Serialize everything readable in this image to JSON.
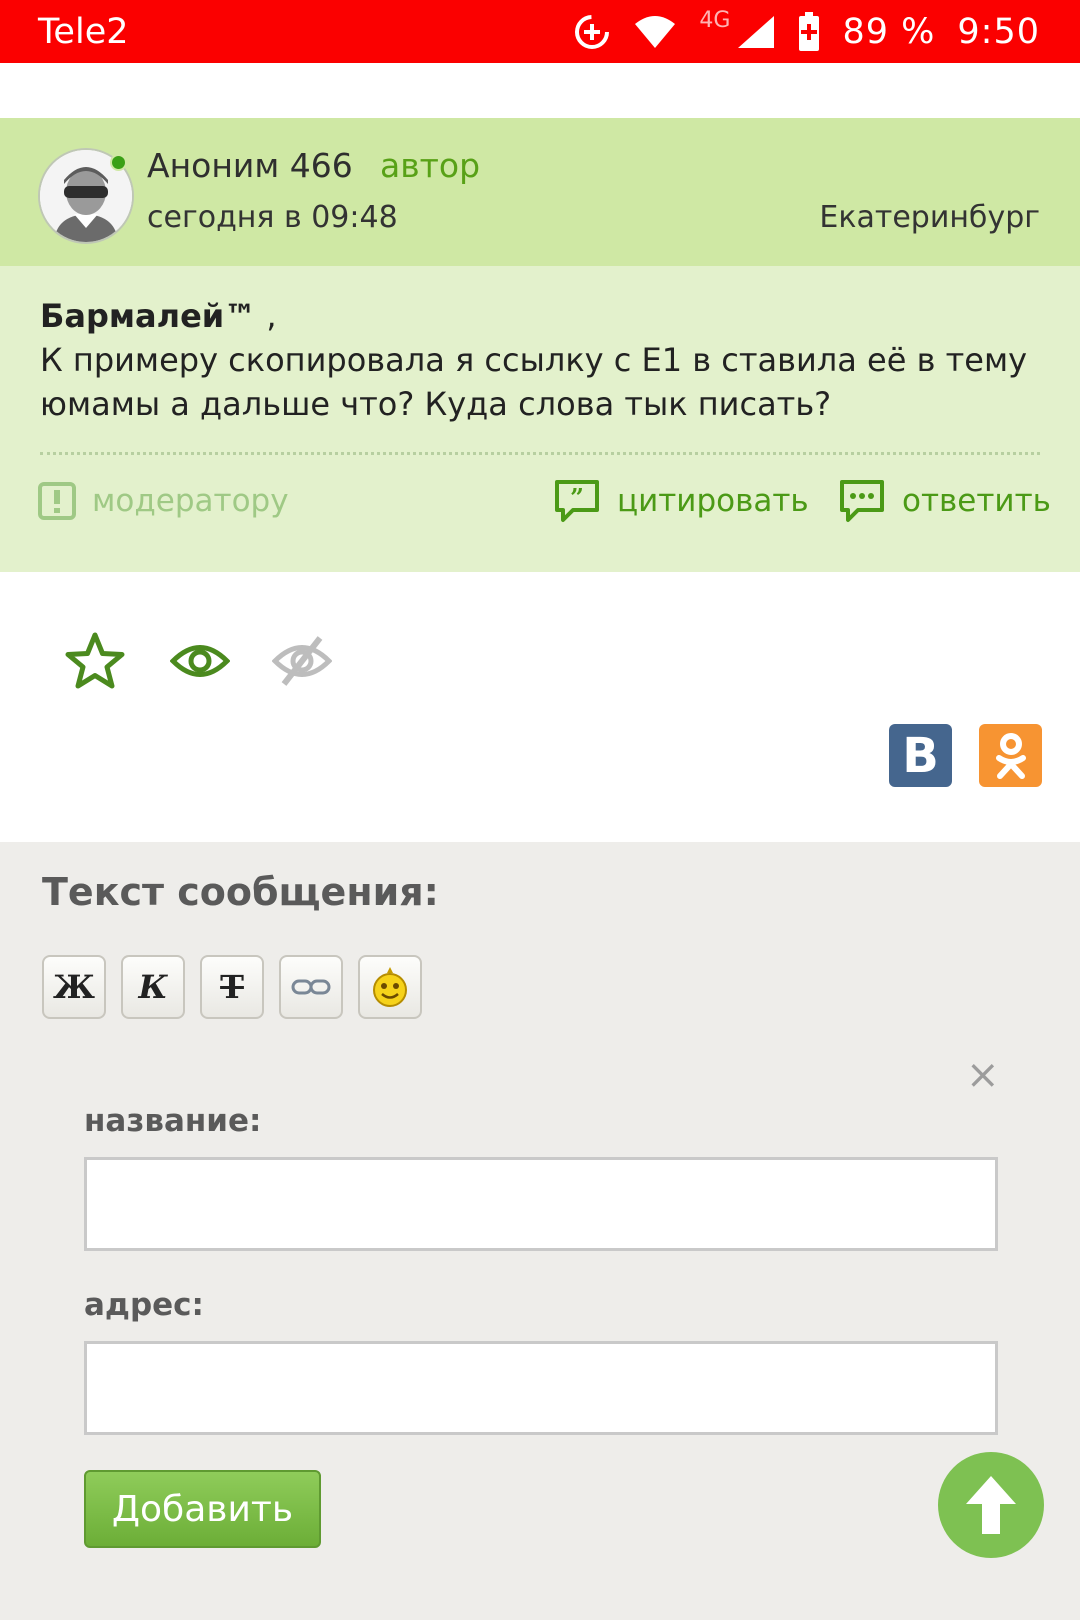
{
  "status_bar": {
    "carrier": "Tele2",
    "network": "4G",
    "battery": "89 %",
    "time": "9:50",
    "icons": [
      "data-saver-icon",
      "wifi-icon",
      "signal-icon",
      "battery-charging-icon"
    ]
  },
  "post": {
    "author_name": "Аноним 466",
    "author_tag": "автор",
    "time": "сегодня в 09:48",
    "city": "Екатеринбург",
    "addressee": "Бармалей™",
    "addressee_suffix": "  ,",
    "body": "К примеру скопировала я ссылку с Е1 в ставила её в тему юмамы а дальше что? Куда слова тык писать?",
    "actions": {
      "moderator": "модератору",
      "quote": "цитировать",
      "reply": "ответить"
    }
  },
  "tools": {
    "icons": [
      "star-icon",
      "eye-icon",
      "eye-off-icon"
    ],
    "share": {
      "vk_label": "В",
      "ok_icon": "odnoklassniki-icon"
    }
  },
  "form": {
    "title": "Текст сообщения:",
    "format_buttons": [
      "Ж",
      "К",
      "Т",
      "link-icon",
      "smiley-icon"
    ],
    "close_symbol": "×",
    "name_label": "название:",
    "name_value": "",
    "address_label": "адрес:",
    "address_value": "",
    "submit_label": "Добавить"
  },
  "colors": {
    "status_bar": "#fb0000",
    "post_header": "#cfe8a4",
    "post_body": "#e3f1cc",
    "accent_green": "#4b9a16",
    "vk": "#45668e",
    "ok": "#f79432",
    "scroll_up": "#7ec152"
  }
}
